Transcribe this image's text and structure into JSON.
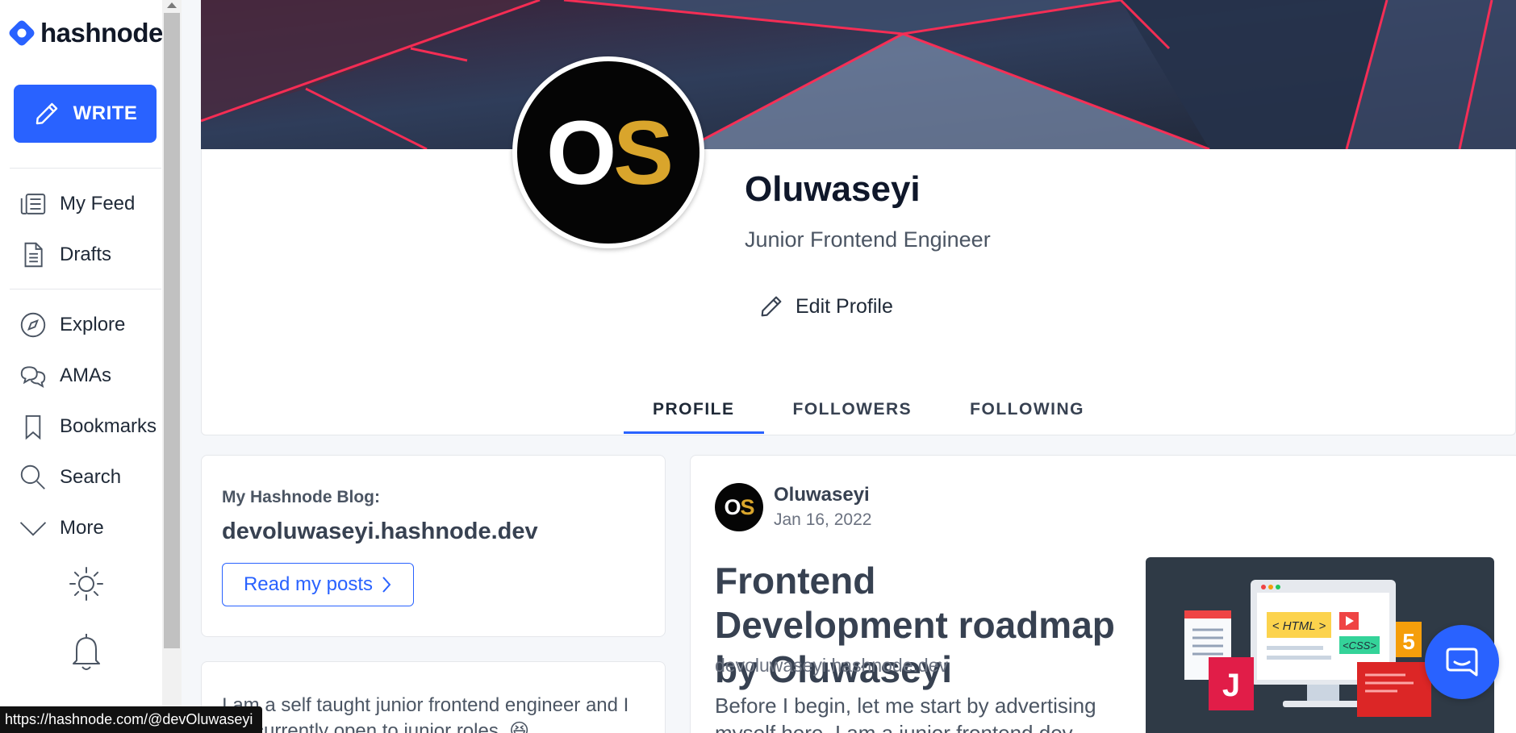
{
  "app": {
    "brand": "hashnode"
  },
  "sidebar": {
    "write_label": "WRITE",
    "items": [
      {
        "label": "My Feed",
        "icon": "feed-icon"
      },
      {
        "label": "Drafts",
        "icon": "document-icon"
      },
      {
        "label": "Explore",
        "icon": "compass-icon"
      },
      {
        "label": "AMAs",
        "icon": "chat-bubbles-icon"
      },
      {
        "label": "Bookmarks",
        "icon": "bookmark-icon"
      },
      {
        "label": "Search",
        "icon": "search-icon"
      },
      {
        "label": "More",
        "icon": "chevron-down-icon"
      }
    ]
  },
  "profile": {
    "avatar_initial_1": "O",
    "avatar_initial_2": "S",
    "name": "Oluwaseyi",
    "tagline": "Junior Frontend Engineer",
    "edit_label": "Edit Profile",
    "tabs": [
      {
        "label": "PROFILE",
        "active": true
      },
      {
        "label": "FOLLOWERS",
        "active": false
      },
      {
        "label": "FOLLOWING",
        "active": false
      }
    ]
  },
  "blog_card": {
    "label": "My Hashnode Blog:",
    "domain": "devoluwaseyi.hashnode.dev",
    "read_label": "Read my posts"
  },
  "bio": {
    "text": "I am a self taught junior frontend engineer and I am currently open to junior roles. 😆"
  },
  "post": {
    "author": "Oluwaseyi",
    "date": "Jan 16, 2022",
    "title": "Frontend Development roadmap by Oluwaseyi",
    "domain": "devoluwaseyi.hashnode.dev",
    "excerpt": "Before I begin, let me start by advertising myself here. I am a junior frontend dev",
    "thumb_html_label": "< HTML >",
    "thumb_css_label": "<CSS>",
    "thumb_html5_badge": "5"
  },
  "status_bar": {
    "url": "https://hashnode.com/@devOluwaseyi"
  },
  "colors": {
    "accent": "#2962ff",
    "avatar_gold": "#d9a52c"
  }
}
